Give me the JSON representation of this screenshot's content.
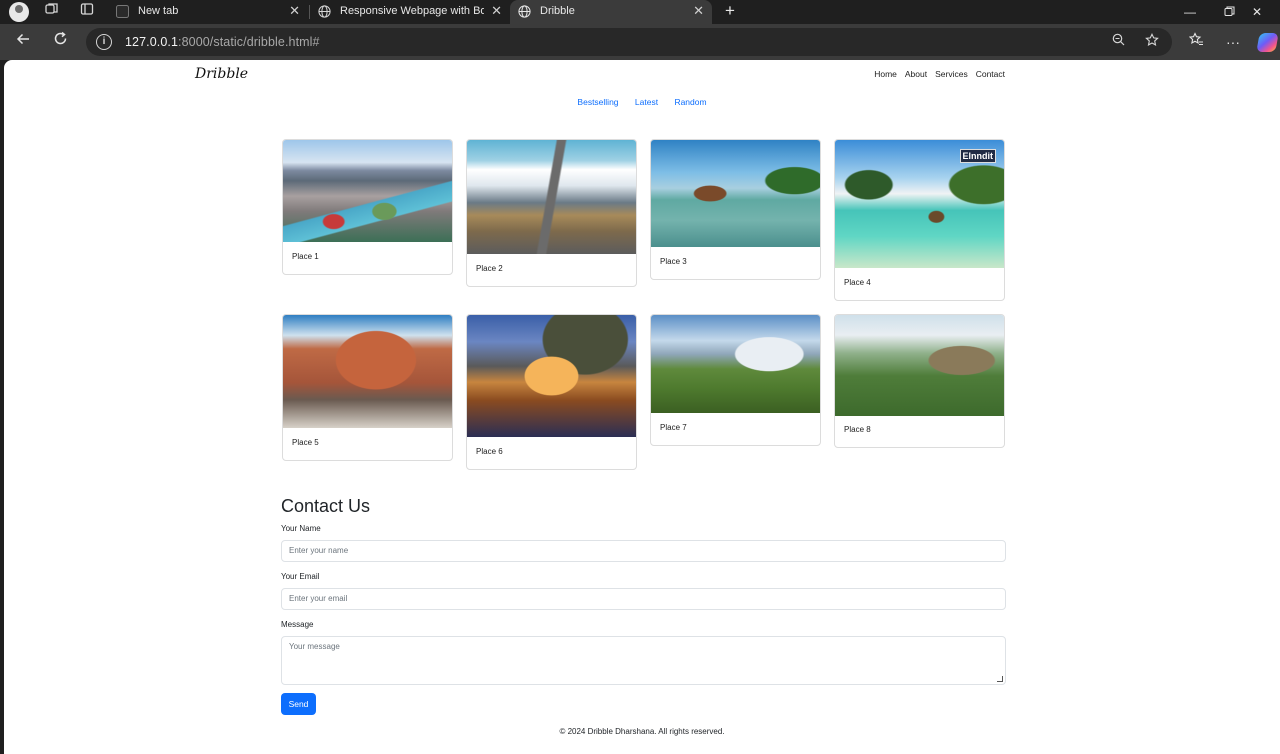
{
  "browser": {
    "tabs": [
      {
        "title": "New tab",
        "active": false
      },
      {
        "title": "Responsive Webpage with Bootst",
        "active": false
      },
      {
        "title": "Dribble",
        "active": true
      }
    ],
    "url_host": "127.0.0.1",
    "url_path": ":8000/static/dribble.html#"
  },
  "page": {
    "brand": "Dribble",
    "nav": [
      "Home",
      "About",
      "Services",
      "Contact"
    ],
    "filters": [
      "Bestselling",
      "Latest",
      "Random"
    ],
    "cards": [
      {
        "label": "Place 1"
      },
      {
        "label": "Place 2"
      },
      {
        "label": "Place 3"
      },
      {
        "label": "Place 4",
        "watermark": "Elnndit"
      },
      {
        "label": "Place 5"
      },
      {
        "label": "Place 6"
      },
      {
        "label": "Place 7"
      },
      {
        "label": "Place 8"
      }
    ],
    "contact": {
      "title": "Contact Us",
      "name_label": "Your Name",
      "name_placeholder": "Enter your name",
      "email_label": "Your Email",
      "email_placeholder": "Enter your email",
      "message_label": "Message",
      "message_placeholder": "Your message",
      "send_label": "Send"
    },
    "footer": "© 2024 Dribble Dharshana. All rights reserved."
  },
  "colors": {
    "link": "#0d6efd",
    "button": "#0d6efd"
  }
}
